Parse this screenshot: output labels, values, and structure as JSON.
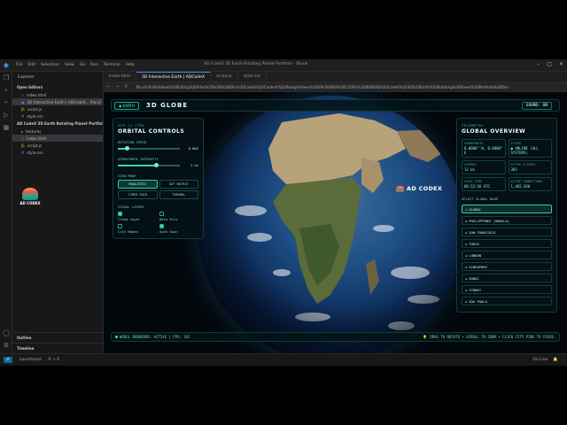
{
  "vscode": {
    "window_title": "AD CodeX 3D Earth Rotating Planet Portfolio · Visual",
    "menu": [
      "File",
      "Edit",
      "Selection",
      "View",
      "Go",
      "Run",
      "Terminal",
      "Help"
    ],
    "explorer_label": "Explorer",
    "open_editors_label": "Open Editors",
    "open_editors": [
      {
        "name": "index.html",
        "icon": "html-file-icon"
      },
      {
        "name": "3D Interactive Earth | ADCodeX... file:///",
        "icon": "preview-icon",
        "active": true
      },
      {
        "name": "script.js",
        "icon": "js-file-icon"
      },
      {
        "name": "style.css",
        "icon": "css-file-icon"
      }
    ],
    "project_label": "AD CodeX 3D Earth Rotating Planet Portfolio...",
    "files": [
      {
        "name": "textures",
        "icon": "folder-icon"
      },
      {
        "name": "index.html",
        "icon": "html-file-icon",
        "active": true
      },
      {
        "name": "script.js",
        "icon": "js-file-icon"
      },
      {
        "name": "style.css",
        "icon": "css-file-icon"
      }
    ],
    "brand_text": "AD CODEX",
    "outline_label": "Outline",
    "timeline_label": "Timeline",
    "tabs": [
      {
        "label": "index.html"
      },
      {
        "label": "3D Interactive Earth | ADCodeX",
        "active": true
      },
      {
        "label": "script.js"
      },
      {
        "label": "style.css"
      }
    ],
    "url": "file:///c%3A/Videos%20Editing%20Files%20%26%20IDEs%20CodeX%20Content%20Ready/Videos%20UPLOADED%20CODEX%20WEB/AD%20CodeX%203D%20Earth%20Rotating%20Planet%20Portfolio%20Developer%20%28Fly%20%2D%2E",
    "status": {
      "launchpad": "Launchpad",
      "problems": "0 ⚠ 0",
      "golive": "Go Live"
    }
  },
  "app": {
    "earth_badge": "EARTH",
    "title": "3D GLOBE",
    "sound": "SOUND: ON",
    "left_panel": {
      "subtitle": "SYS // CTRL",
      "title": "ORBITAL CONTROLS",
      "rotation_label": "ROTATION SPEED",
      "rotation_value": "0.002",
      "rotation_fraction": 0.15,
      "atmosphere_label": "ATMOSPHERE INTENSITY",
      "atmosphere_value": "1.4x",
      "atmosphere_fraction": 0.62,
      "view_mode_label": "VIEW MODE",
      "modes": [
        {
          "label": "REALISTIC",
          "selected": true
        },
        {
          "label": "DOT MATRIX",
          "selected": false
        },
        {
          "label": "CYBER GRID",
          "selected": false
        },
        {
          "label": "THERMAL",
          "selected": false
        }
      ],
      "layers_label": "VISUAL LAYERS",
      "layers": [
        {
          "label": "Cloud Layer",
          "checked": true
        },
        {
          "label": "Data Arcs",
          "checked": false
        },
        {
          "label": "City Nodes",
          "checked": false
        },
        {
          "label": "Auto Spin",
          "checked": true
        }
      ]
    },
    "right_panel": {
      "subtitle": "TELEMETRY",
      "title": "GLOBAL OVERVIEW",
      "cells": [
        {
          "k": "COORDINATES",
          "v": "0.0000° N, 0.0000° E"
        },
        {
          "k": "STATUS",
          "v": "● ONLINE (ALL SYSTEMS)"
        },
        {
          "k": "LATENCY",
          "v": "12 ms"
        },
        {
          "k": "ACTIVE CLIENTS",
          "v": "365"
        },
        {
          "k": "LOCAL TIME",
          "v": "06:52:56 UTC"
        },
        {
          "k": "ACTIVE CONNECTIONS",
          "v": "1,482,930"
        }
      ],
      "select_label": "SELECT GLOBAL NODE",
      "nodes": [
        {
          "label": "GLOBAL",
          "selected": true
        },
        {
          "label": "PHILIPPINES (MANILA)"
        },
        {
          "label": "SAN FRANCISCO"
        },
        {
          "label": "TOKYO"
        },
        {
          "label": "LONDON"
        },
        {
          "label": "SINGAPORE"
        },
        {
          "label": "DUBAI"
        },
        {
          "label": "SYDNEY"
        },
        {
          "label": "SÃO PAULO"
        }
      ]
    },
    "overlay_brand": "AD CODEX",
    "footer_left": "WEBGL RENDERER: ACTIVE | FPS: 165",
    "footer_right": "DRAG TO ROTATE • SCROLL TO ZOOM • CLICK CITY PINS TO FOCUS"
  },
  "colors": {
    "accent": "#3fe0cb",
    "panel_bg": "#04121a",
    "title": "#e6fbff"
  }
}
